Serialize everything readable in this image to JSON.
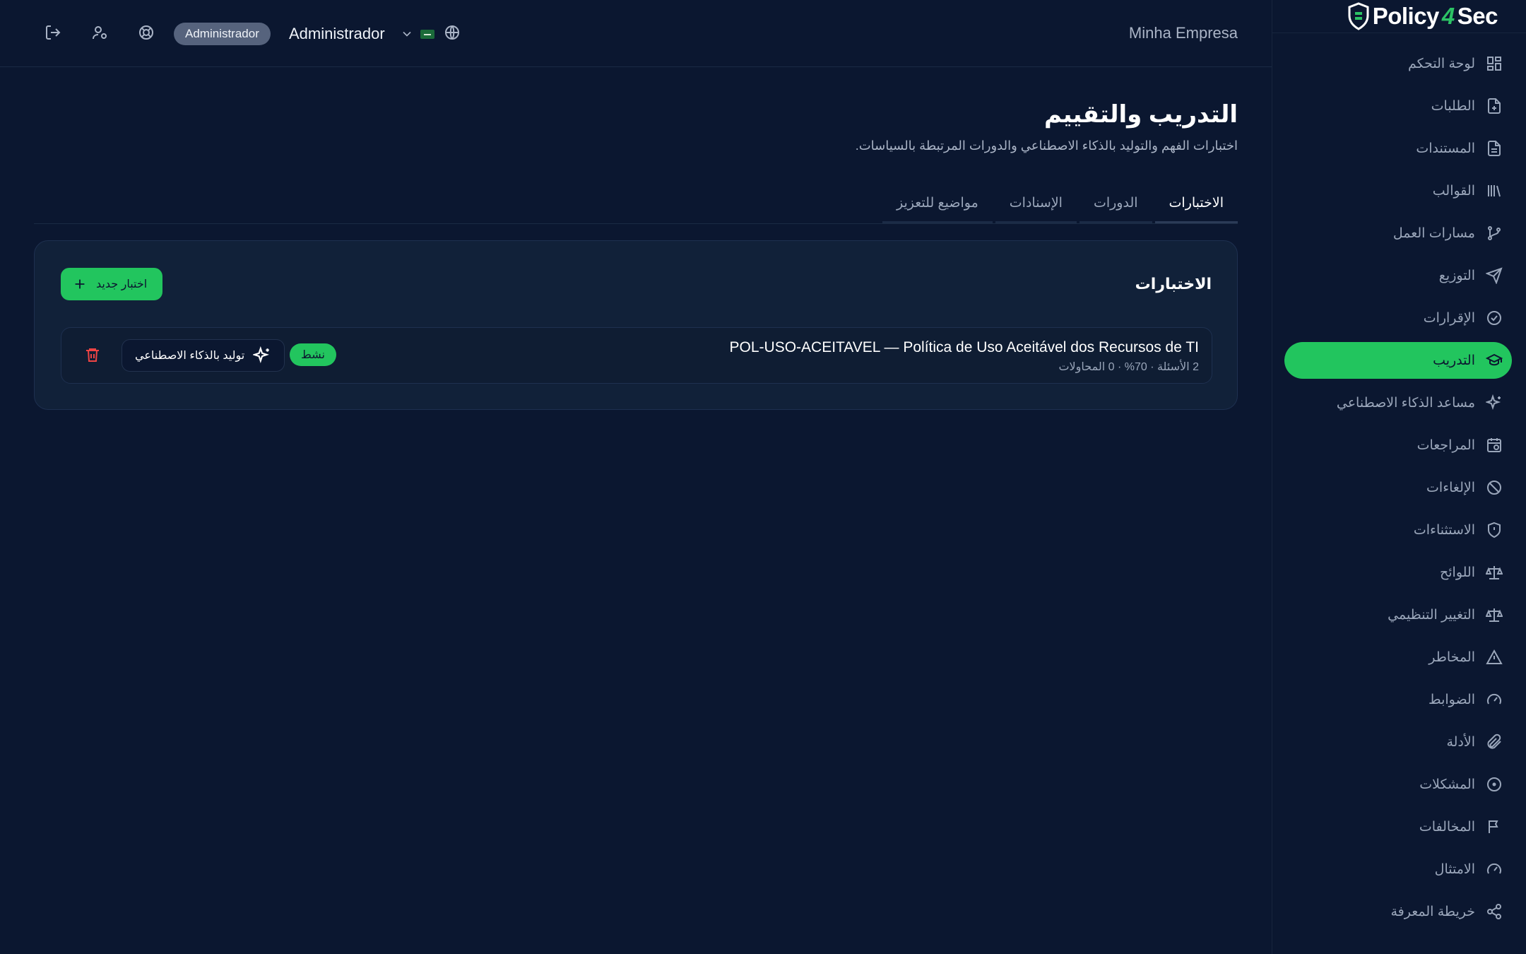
{
  "brand": {
    "name_a": "Policy",
    "name_b": "4",
    "name_c": "Sec"
  },
  "header": {
    "company": "Minha Empresa",
    "role_badge": "Administrador",
    "user_name": "Administrador",
    "icons": [
      "logout-icon",
      "user-settings-icon",
      "help-icon",
      "chevron-down-icon",
      "flag-icon",
      "globe-icon"
    ]
  },
  "sidebar": {
    "items": [
      {
        "label": "لوحة التحكم",
        "icon": "dashboard-icon"
      },
      {
        "label": "الطلبات",
        "icon": "file-plus-icon"
      },
      {
        "label": "المستندات",
        "icon": "document-icon"
      },
      {
        "label": "القوالب",
        "icon": "library-icon"
      },
      {
        "label": "مسارات العمل",
        "icon": "workflow-icon"
      },
      {
        "label": "التوزيع",
        "icon": "send-icon"
      },
      {
        "label": "الإقرارات",
        "icon": "check-circle-icon"
      },
      {
        "label": "التدريب",
        "icon": "graduation-cap-icon",
        "active": true
      },
      {
        "label": "مساعد الذكاء الاصطناعي",
        "icon": "sparkles-icon"
      },
      {
        "label": "المراجعات",
        "icon": "calendar-clock-icon"
      },
      {
        "label": "الإلغاءات",
        "icon": "ban-icon"
      },
      {
        "label": "الاستثناءات",
        "icon": "shield-alert-icon"
      },
      {
        "label": "اللوائح",
        "icon": "scale-icon"
      },
      {
        "label": "التغيير التنظيمي",
        "icon": "scale-icon"
      },
      {
        "label": "المخاطر",
        "icon": "warning-icon"
      },
      {
        "label": "الضوابط",
        "icon": "gauge-icon"
      },
      {
        "label": "الأدلة",
        "icon": "paperclip-icon"
      },
      {
        "label": "المشكلات",
        "icon": "circle-dot-icon"
      },
      {
        "label": "المخالفات",
        "icon": "flag-icon"
      },
      {
        "label": "الامتثال",
        "icon": "gauge-icon"
      },
      {
        "label": "خريطة المعرفة",
        "icon": "share-icon"
      }
    ]
  },
  "main": {
    "title": "التدريب والتقييم",
    "subtitle": "اختبارات الفهم والتوليد بالذكاء الاصطناعي والدورات المرتبطة بالسياسات.",
    "tabs": [
      {
        "label": "الاختبارات",
        "active": true
      },
      {
        "label": "الدورات"
      },
      {
        "label": "الإسنادات"
      },
      {
        "label": "مواضيع للتعزيز"
      }
    ],
    "card": {
      "title": "الاختبارات",
      "new_button": "اختبار جديد",
      "quizzes": [
        {
          "title": "POL-USO-ACEITAVEL — Política de Uso Aceitável dos Recursos de TI",
          "meta": "2 الأسئلة · 70% · 0 المحاولات",
          "status": "نشط",
          "ai_button": "توليد بالذكاء الاصطناعي"
        }
      ]
    }
  },
  "colors": {
    "accent": "#22c55e",
    "background": "#0b1730",
    "danger": "#ef4444"
  }
}
